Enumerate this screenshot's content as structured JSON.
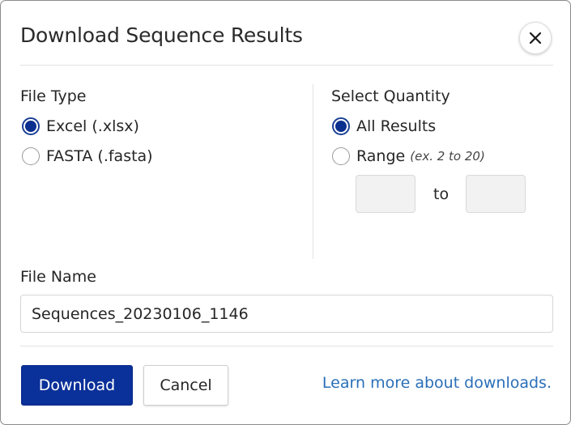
{
  "dialog": {
    "title": "Download Sequence Results",
    "close_icon": "close-icon"
  },
  "file_type": {
    "label": "File Type",
    "options": [
      {
        "label": "Excel (.xlsx)",
        "checked": true
      },
      {
        "label": "FASTA (.fasta)",
        "checked": false
      }
    ]
  },
  "quantity": {
    "label": "Select Quantity",
    "options": [
      {
        "label": "All Results",
        "checked": true
      },
      {
        "label": "Range",
        "hint": "(ex. 2 to 20)",
        "checked": false
      }
    ],
    "range_from": "",
    "range_to": "",
    "to_label": "to"
  },
  "file_name": {
    "label": "File Name",
    "value": "Sequences_20230106_1146"
  },
  "actions": {
    "download_label": "Download",
    "cancel_label": "Cancel",
    "learn_more_label": "Learn more about downloads."
  },
  "colors": {
    "primary": "#0a3099",
    "radio_checked": "#0b2f8f",
    "link": "#2a6fb8",
    "border": "#8a8a8a"
  }
}
